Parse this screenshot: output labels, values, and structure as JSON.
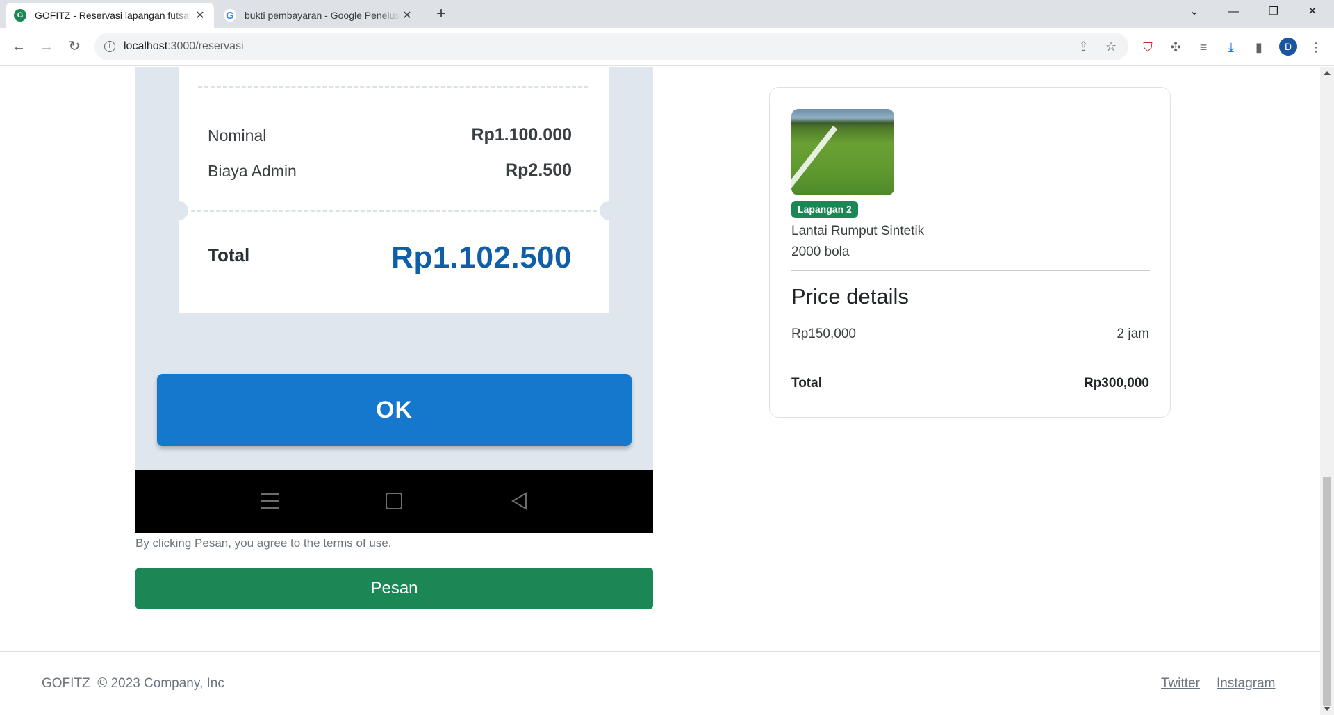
{
  "browser": {
    "tabs": [
      {
        "title": "GOFITZ - Reservasi lapangan futsal",
        "active": true
      },
      {
        "title": "bukti pembayaran - Google Penelusuran",
        "active": false
      }
    ],
    "url_host": "localhost",
    "url_path": ":3000/reservasi",
    "profile_initial": "D"
  },
  "phone": {
    "nominal_label": "Nominal",
    "nominal_value": "Rp1.100.000",
    "admin_label": "Biaya Admin",
    "admin_value": "Rp2.500",
    "total_label": "Total",
    "total_value": "Rp1.102.500",
    "ok_label": "OK"
  },
  "form": {
    "terms_text": "By clicking Pesan, you agree to the terms of use.",
    "submit_label": "Pesan"
  },
  "card": {
    "badge": "Lapangan 2",
    "floor": "Lantai Rumput Sintetik",
    "balls": "2000 bola",
    "price_heading": "Price details",
    "price": "Rp150,000",
    "duration": "2 jam",
    "total_label": "Total",
    "total_value": "Rp300,000"
  },
  "footer": {
    "copyright": "GOFITZ  © 2023 Company, Inc",
    "links": [
      "Twitter",
      "Instagram"
    ]
  },
  "colors": {
    "brand_green": "#1a8754",
    "ok_blue": "#1578cc",
    "total_blue": "#0f5fa8"
  }
}
